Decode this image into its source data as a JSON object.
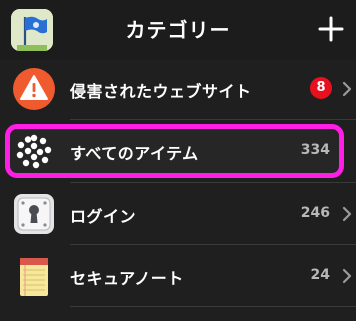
{
  "header": {
    "title": "カテゴリー"
  },
  "rows": [
    {
      "label": "侵害されたウェブサイト",
      "badge": "8",
      "icon": "warning-icon"
    },
    {
      "label": "すべてのアイテム",
      "count": "334",
      "icon": "all-items-dots-icon"
    },
    {
      "label": "ログイン",
      "count": "246",
      "icon": "login-keyhole-icon"
    },
    {
      "label": "セキュアノート",
      "count": "24",
      "icon": "secure-note-notepad-icon"
    }
  ],
  "colors": {
    "highlight": "#ff1ee6",
    "badge": "#e8101e",
    "warning": "#ef5a2e"
  }
}
